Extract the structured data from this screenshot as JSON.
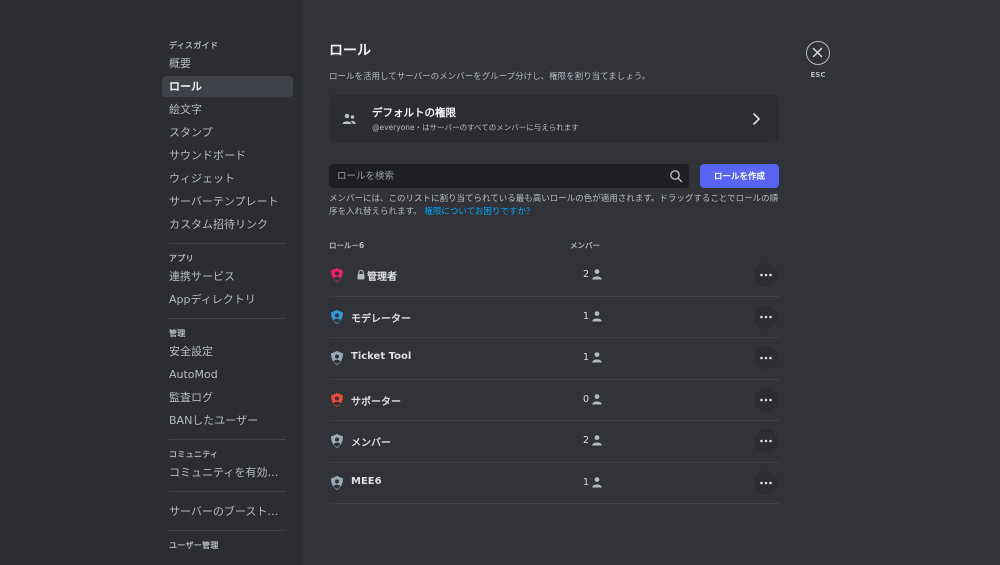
{
  "sidebar": {
    "sections": [
      {
        "header": "ディスガイド",
        "items": [
          {
            "label": "概要",
            "active": false
          },
          {
            "label": "ロール",
            "active": true
          },
          {
            "label": "絵文字",
            "active": false
          },
          {
            "label": "スタンプ",
            "active": false
          },
          {
            "label": "サウンドボード",
            "active": false
          },
          {
            "label": "ウィジェット",
            "active": false
          },
          {
            "label": "サーバーテンプレート",
            "active": false
          },
          {
            "label": "カスタム招待リンク",
            "active": false
          }
        ]
      },
      {
        "header": "アプリ",
        "items": [
          {
            "label": "連携サービス",
            "active": false
          },
          {
            "label": "Appディレクトリ",
            "active": false
          }
        ]
      },
      {
        "header": "管理",
        "items": [
          {
            "label": "安全設定",
            "active": false
          },
          {
            "label": "AutoMod",
            "active": false
          },
          {
            "label": "監査ログ",
            "active": false
          },
          {
            "label": "BANしたユーザー",
            "active": false
          }
        ]
      },
      {
        "header": "コミュニティ",
        "items": [
          {
            "label": "コミュニティを有効に…",
            "active": false
          }
        ]
      },
      {
        "header": "",
        "items": [
          {
            "label": "サーバーのブースト状態",
            "active": false
          }
        ]
      },
      {
        "header": "ユーザー管理",
        "items": []
      }
    ]
  },
  "main": {
    "title": "ロール",
    "subtitle": "ロールを活用してサーバーのメンバーをグループ分けし、権限を割り当てましょう。",
    "default_perms": {
      "title": "デフォルトの権限",
      "description": "@everyone・はサーバーのすべてのメンバーに与えられます"
    },
    "search_placeholder": "ロールを検索",
    "create_label": "ロールを作成",
    "help_text": "メンバーには、このリストに割り当てられている最も高いロールの色が適用されます。ドラッグすることでロールの順序を入れ替えられます。",
    "help_link": "権限についてお困りですか？",
    "col_roles": "ロール－6",
    "col_members": "メンバー",
    "roles": [
      {
        "name": "管理者",
        "count": "2",
        "color": "#e91e63",
        "locked": true
      },
      {
        "name": "モデレーター",
        "count": "1",
        "color": "#3498db",
        "locked": false
      },
      {
        "name": "Ticket Tool",
        "count": "1",
        "color": "#99aab5",
        "locked": false
      },
      {
        "name": "サポーター",
        "count": "0",
        "color": "#e74c3c",
        "locked": false
      },
      {
        "name": "メンバー",
        "count": "2",
        "color": "#99aab5",
        "locked": false
      },
      {
        "name": "MEE6",
        "count": "1",
        "color": "#99aab5",
        "locked": false
      }
    ]
  },
  "esc_label": "ESC"
}
